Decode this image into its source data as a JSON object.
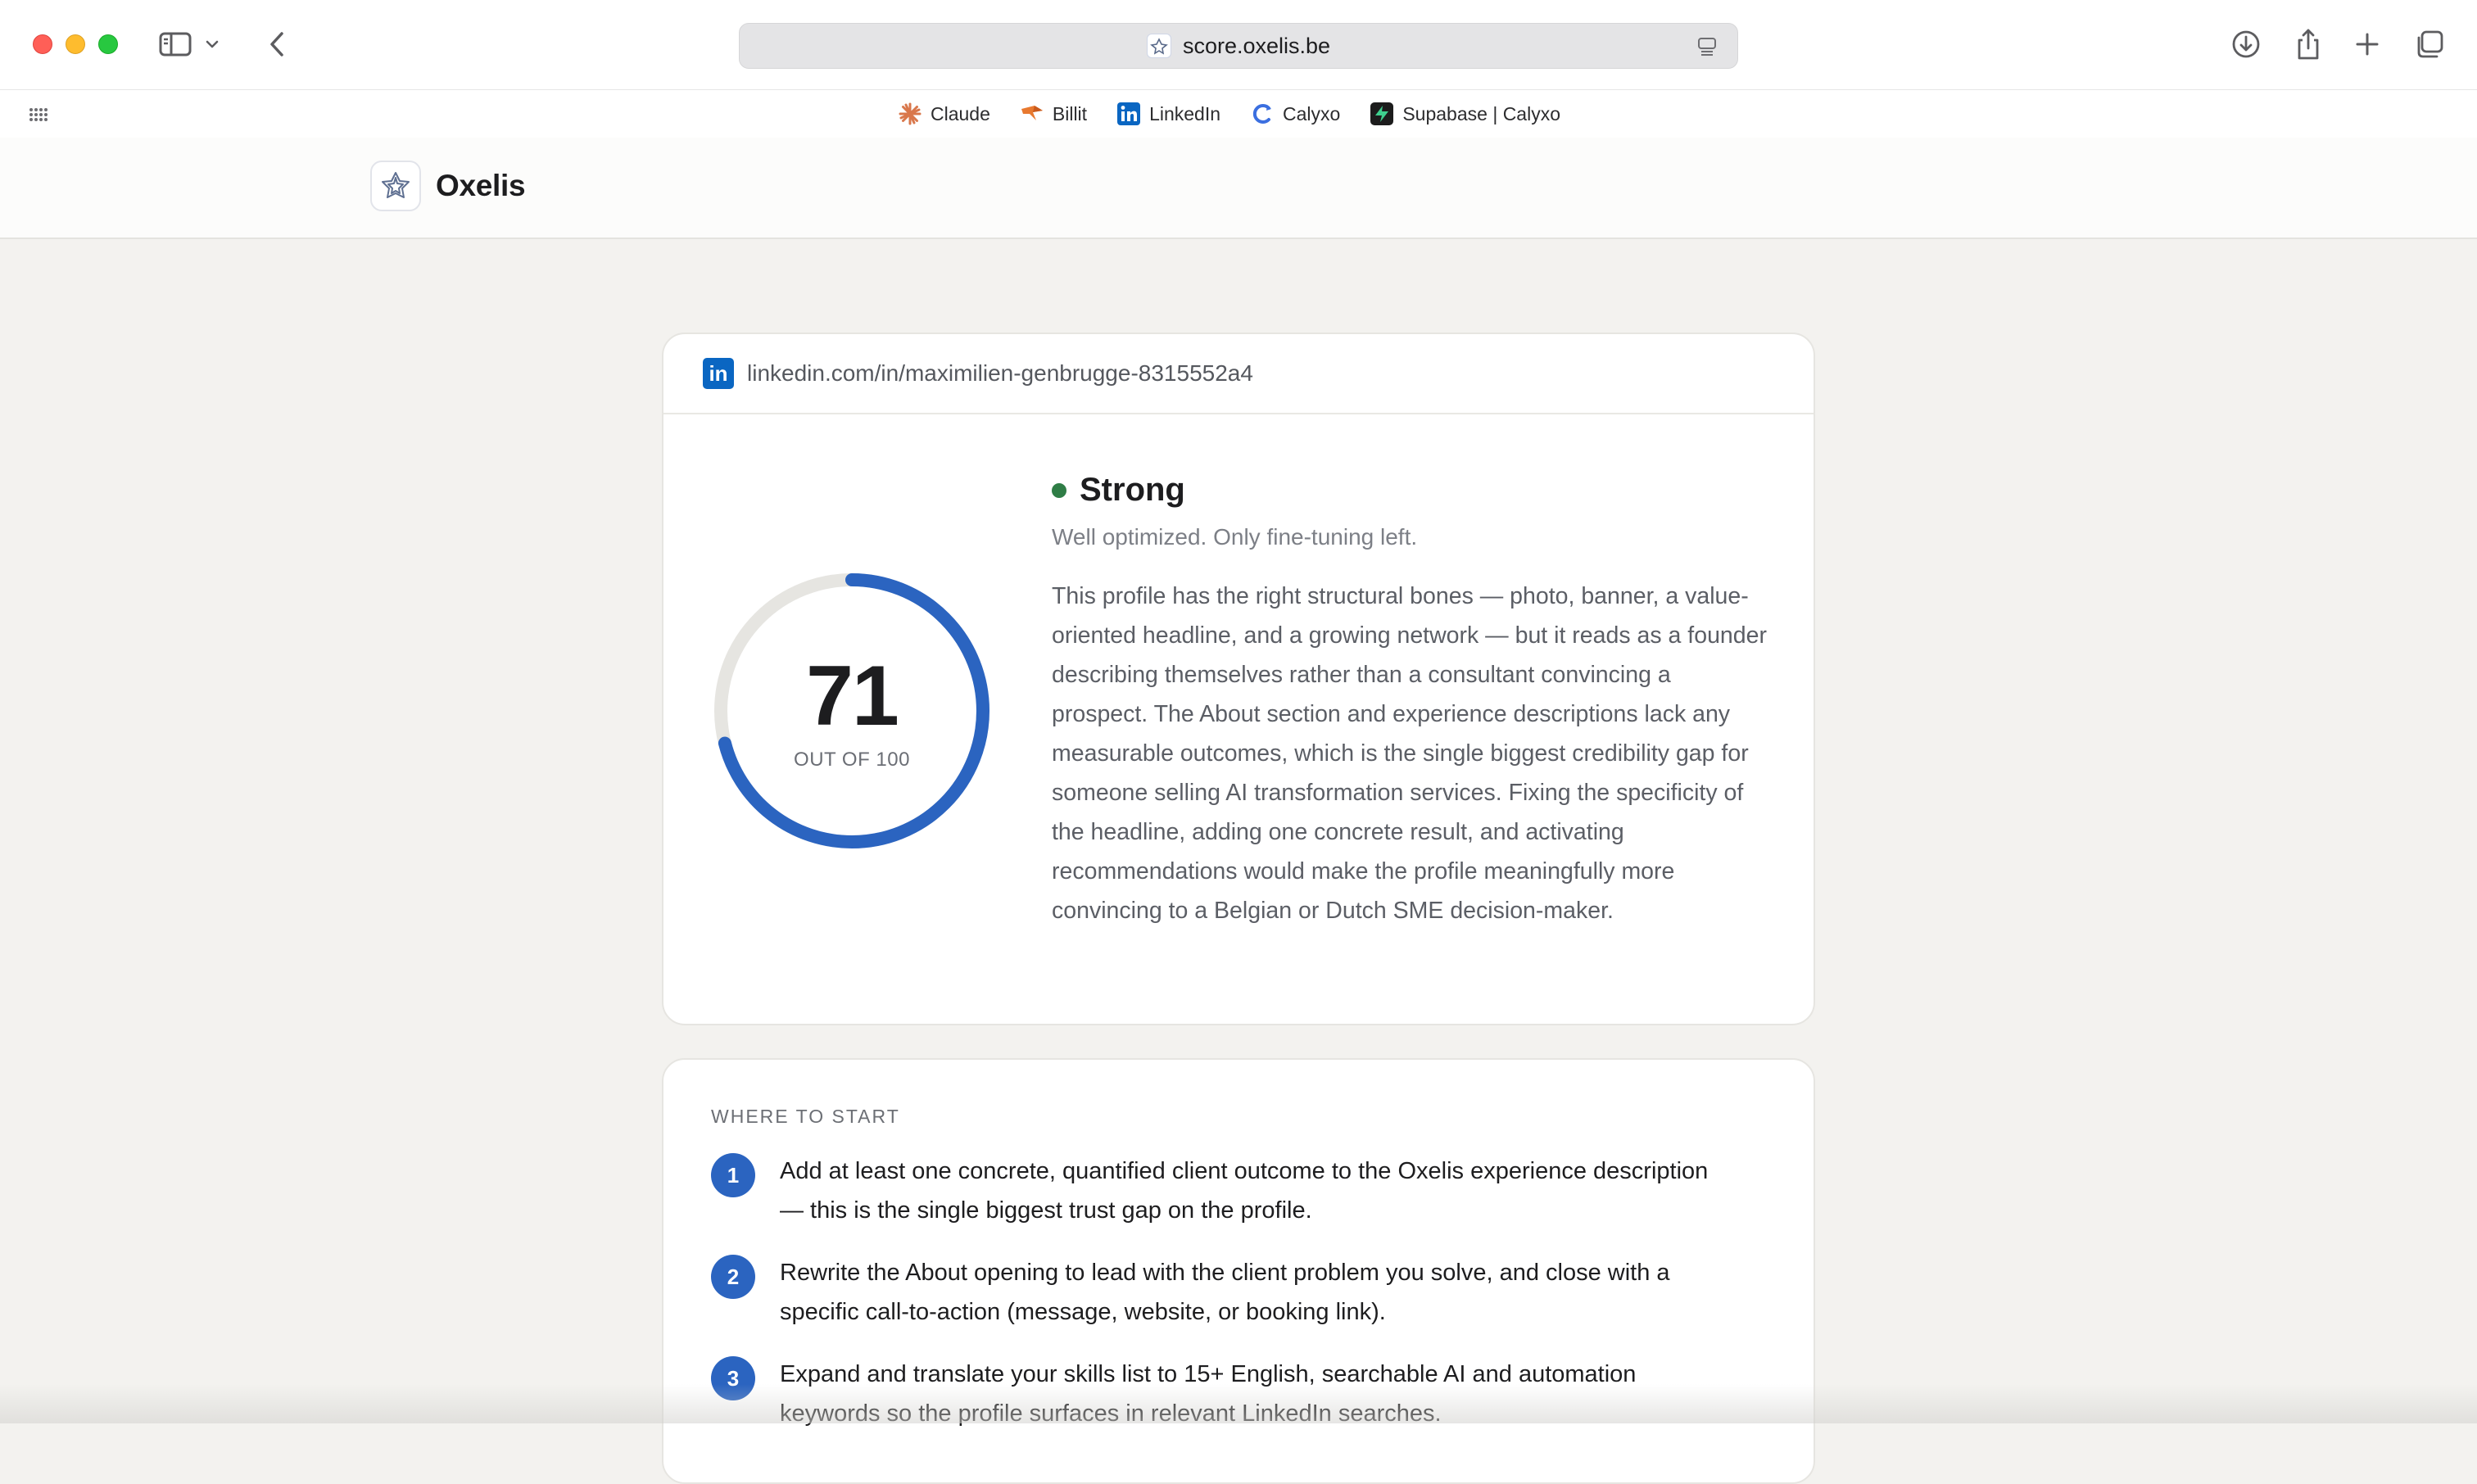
{
  "browser": {
    "url": "score.oxelis.be",
    "bookmarks": [
      {
        "label": "Claude",
        "icon": "claude-icon"
      },
      {
        "label": "Billit",
        "icon": "billit-icon"
      },
      {
        "label": "LinkedIn",
        "icon": "linkedin-icon"
      },
      {
        "label": "Calyxo",
        "icon": "calyxo-icon"
      },
      {
        "label": "Supabase | Calyxo",
        "icon": "supabase-icon"
      }
    ]
  },
  "site": {
    "brand_name": "Oxelis"
  },
  "score_card": {
    "profile_url": "linkedin.com/in/maximilien-genbrugge-8315552a4",
    "score": "71",
    "score_value": 71,
    "score_max": 100,
    "score_label": "OUT OF 100",
    "verdict": "Strong",
    "verdict_color": "#2f7d46",
    "verdict_subtitle": "Well optimized. Only fine-tuning left.",
    "summary": "This profile has the right structural bones — photo, banner, a value-oriented headline, and a growing network — but it reads as a founder describing themselves rather than a consultant convincing a prospect. The About section and experience descriptions lack any measurable outcomes, which is the single biggest credibility gap for someone selling AI transformation services. Fixing the specificity of the headline, adding one concrete result, and activating recommendations would make the profile meaningfully more convincing to a Belgian or Dutch SME decision-maker.",
    "accent_color": "#2b64c0"
  },
  "where_to_start": {
    "heading": "WHERE TO START",
    "steps": [
      {
        "num": "1",
        "text": "Add at least one concrete, quantified client outcome to the Oxelis experience description — this is the single biggest trust gap on the profile."
      },
      {
        "num": "2",
        "text": "Rewrite the About opening to lead with the client problem you solve, and close with a specific call-to-action (message, website, or booking link)."
      },
      {
        "num": "3",
        "text": "Expand and translate your skills list to 15+ English, searchable AI and automation keywords so the profile surfaces in relevant LinkedIn searches."
      }
    ]
  }
}
